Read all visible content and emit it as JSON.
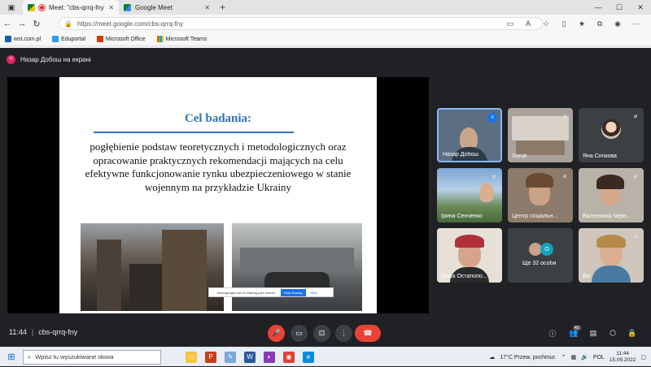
{
  "browser": {
    "tabs": [
      {
        "title": "Meet: \"cbs-qrrq-fny\"",
        "active": true
      },
      {
        "title": "Google Meet",
        "active": false
      }
    ],
    "url": "https://meet.google.com/cbs-qrrq-fny",
    "bookmarks": [
      "wst.com.pl",
      "Eduportal",
      "Microsoft Office",
      "Microsoft Teams"
    ]
  },
  "meet": {
    "presenting_label": "Назар Добош на екрані",
    "presenter_initial": "Н",
    "meeting_time": "11:44",
    "meeting_code": "cbs-qrrq-fny",
    "participant_count": "42",
    "more_count_label": "Ще 32 особи",
    "more_initial": "O",
    "slide": {
      "title": "Cel badania:",
      "body": "pogłębienie podstaw teoretycznych i metodologicznych oraz opracowanie praktycznych rekomendacji mających na celu efektywne funkcjonowanie rynku ubezpieczeniowego w stanie wojennym na przykładzie Ukrainy",
      "share_notice": "meet.google.com is sharing your screen.",
      "stop_sharing": "Stop sharing",
      "hide": "Hide"
    },
    "participants": [
      {
        "name": "Назар Добош"
      },
      {
        "name": "Sanat"
      },
      {
        "name": "Яна Сичкова"
      },
      {
        "name": "Ірина Сенченко"
      },
      {
        "name": "Центр соціальн..."
      },
      {
        "name": "Валентина Черн..."
      },
      {
        "name": "Ірина Остапопо..."
      },
      {
        "name": "Ви"
      }
    ]
  },
  "taskbar": {
    "search_placeholder": "Wpisz tu wyszukiwane słowa",
    "weather": "17°C  Przew. pochmur.",
    "lang": "POL",
    "time": "11:44",
    "date": "15.09.2022"
  }
}
